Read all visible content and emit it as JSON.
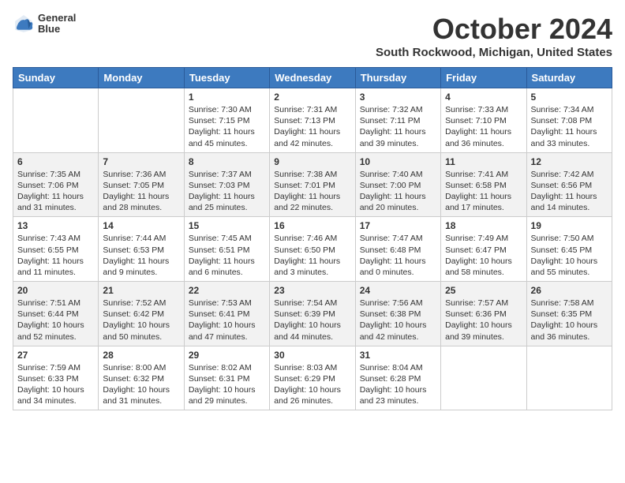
{
  "header": {
    "logo_line1": "General",
    "logo_line2": "Blue",
    "month_title": "October 2024",
    "location": "South Rockwood, Michigan, United States"
  },
  "weekdays": [
    "Sunday",
    "Monday",
    "Tuesday",
    "Wednesday",
    "Thursday",
    "Friday",
    "Saturday"
  ],
  "weeks": [
    [
      {
        "day": null
      },
      {
        "day": null
      },
      {
        "day": "1",
        "sunrise": "Sunrise: 7:30 AM",
        "sunset": "Sunset: 7:15 PM",
        "daylight": "Daylight: 11 hours and 45 minutes."
      },
      {
        "day": "2",
        "sunrise": "Sunrise: 7:31 AM",
        "sunset": "Sunset: 7:13 PM",
        "daylight": "Daylight: 11 hours and 42 minutes."
      },
      {
        "day": "3",
        "sunrise": "Sunrise: 7:32 AM",
        "sunset": "Sunset: 7:11 PM",
        "daylight": "Daylight: 11 hours and 39 minutes."
      },
      {
        "day": "4",
        "sunrise": "Sunrise: 7:33 AM",
        "sunset": "Sunset: 7:10 PM",
        "daylight": "Daylight: 11 hours and 36 minutes."
      },
      {
        "day": "5",
        "sunrise": "Sunrise: 7:34 AM",
        "sunset": "Sunset: 7:08 PM",
        "daylight": "Daylight: 11 hours and 33 minutes."
      }
    ],
    [
      {
        "day": "6",
        "sunrise": "Sunrise: 7:35 AM",
        "sunset": "Sunset: 7:06 PM",
        "daylight": "Daylight: 11 hours and 31 minutes."
      },
      {
        "day": "7",
        "sunrise": "Sunrise: 7:36 AM",
        "sunset": "Sunset: 7:05 PM",
        "daylight": "Daylight: 11 hours and 28 minutes."
      },
      {
        "day": "8",
        "sunrise": "Sunrise: 7:37 AM",
        "sunset": "Sunset: 7:03 PM",
        "daylight": "Daylight: 11 hours and 25 minutes."
      },
      {
        "day": "9",
        "sunrise": "Sunrise: 7:38 AM",
        "sunset": "Sunset: 7:01 PM",
        "daylight": "Daylight: 11 hours and 22 minutes."
      },
      {
        "day": "10",
        "sunrise": "Sunrise: 7:40 AM",
        "sunset": "Sunset: 7:00 PM",
        "daylight": "Daylight: 11 hours and 20 minutes."
      },
      {
        "day": "11",
        "sunrise": "Sunrise: 7:41 AM",
        "sunset": "Sunset: 6:58 PM",
        "daylight": "Daylight: 11 hours and 17 minutes."
      },
      {
        "day": "12",
        "sunrise": "Sunrise: 7:42 AM",
        "sunset": "Sunset: 6:56 PM",
        "daylight": "Daylight: 11 hours and 14 minutes."
      }
    ],
    [
      {
        "day": "13",
        "sunrise": "Sunrise: 7:43 AM",
        "sunset": "Sunset: 6:55 PM",
        "daylight": "Daylight: 11 hours and 11 minutes."
      },
      {
        "day": "14",
        "sunrise": "Sunrise: 7:44 AM",
        "sunset": "Sunset: 6:53 PM",
        "daylight": "Daylight: 11 hours and 9 minutes."
      },
      {
        "day": "15",
        "sunrise": "Sunrise: 7:45 AM",
        "sunset": "Sunset: 6:51 PM",
        "daylight": "Daylight: 11 hours and 6 minutes."
      },
      {
        "day": "16",
        "sunrise": "Sunrise: 7:46 AM",
        "sunset": "Sunset: 6:50 PM",
        "daylight": "Daylight: 11 hours and 3 minutes."
      },
      {
        "day": "17",
        "sunrise": "Sunrise: 7:47 AM",
        "sunset": "Sunset: 6:48 PM",
        "daylight": "Daylight: 11 hours and 0 minutes."
      },
      {
        "day": "18",
        "sunrise": "Sunrise: 7:49 AM",
        "sunset": "Sunset: 6:47 PM",
        "daylight": "Daylight: 10 hours and 58 minutes."
      },
      {
        "day": "19",
        "sunrise": "Sunrise: 7:50 AM",
        "sunset": "Sunset: 6:45 PM",
        "daylight": "Daylight: 10 hours and 55 minutes."
      }
    ],
    [
      {
        "day": "20",
        "sunrise": "Sunrise: 7:51 AM",
        "sunset": "Sunset: 6:44 PM",
        "daylight": "Daylight: 10 hours and 52 minutes."
      },
      {
        "day": "21",
        "sunrise": "Sunrise: 7:52 AM",
        "sunset": "Sunset: 6:42 PM",
        "daylight": "Daylight: 10 hours and 50 minutes."
      },
      {
        "day": "22",
        "sunrise": "Sunrise: 7:53 AM",
        "sunset": "Sunset: 6:41 PM",
        "daylight": "Daylight: 10 hours and 47 minutes."
      },
      {
        "day": "23",
        "sunrise": "Sunrise: 7:54 AM",
        "sunset": "Sunset: 6:39 PM",
        "daylight": "Daylight: 10 hours and 44 minutes."
      },
      {
        "day": "24",
        "sunrise": "Sunrise: 7:56 AM",
        "sunset": "Sunset: 6:38 PM",
        "daylight": "Daylight: 10 hours and 42 minutes."
      },
      {
        "day": "25",
        "sunrise": "Sunrise: 7:57 AM",
        "sunset": "Sunset: 6:36 PM",
        "daylight": "Daylight: 10 hours and 39 minutes."
      },
      {
        "day": "26",
        "sunrise": "Sunrise: 7:58 AM",
        "sunset": "Sunset: 6:35 PM",
        "daylight": "Daylight: 10 hours and 36 minutes."
      }
    ],
    [
      {
        "day": "27",
        "sunrise": "Sunrise: 7:59 AM",
        "sunset": "Sunset: 6:33 PM",
        "daylight": "Daylight: 10 hours and 34 minutes."
      },
      {
        "day": "28",
        "sunrise": "Sunrise: 8:00 AM",
        "sunset": "Sunset: 6:32 PM",
        "daylight": "Daylight: 10 hours and 31 minutes."
      },
      {
        "day": "29",
        "sunrise": "Sunrise: 8:02 AM",
        "sunset": "Sunset: 6:31 PM",
        "daylight": "Daylight: 10 hours and 29 minutes."
      },
      {
        "day": "30",
        "sunrise": "Sunrise: 8:03 AM",
        "sunset": "Sunset: 6:29 PM",
        "daylight": "Daylight: 10 hours and 26 minutes."
      },
      {
        "day": "31",
        "sunrise": "Sunrise: 8:04 AM",
        "sunset": "Sunset: 6:28 PM",
        "daylight": "Daylight: 10 hours and 23 minutes."
      },
      {
        "day": null
      },
      {
        "day": null
      }
    ]
  ]
}
